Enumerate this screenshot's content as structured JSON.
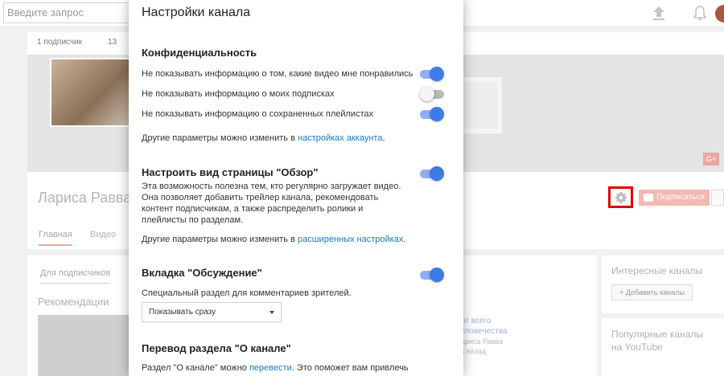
{
  "topbar": {
    "search_placeholder": "Введите запрос"
  },
  "channel": {
    "subscribers_text": "1 подписчик",
    "views_text": "13",
    "name": "Лариса Равва",
    "tabs": [
      "Главная",
      "Видео"
    ],
    "subscribe_label": "Подписаться",
    "gplus_label": "G+"
  },
  "content": {
    "for_subscribers_tab": "Для подписчиков",
    "recommendations_title": "Рекомендации",
    "video_title_line1": "- от всего",
    "video_title_line2": "человечества",
    "video_author": "Лариса Равва",
    "video_age": "да назад"
  },
  "sidebar": {
    "interesting_title": "Интересные каналы",
    "add_channels_label": "+ Добавить каналы",
    "popular_title": "Популярные каналы на YouTube"
  },
  "dialog": {
    "title": "Настройки канала",
    "privacy": {
      "heading": "Конфиденциальность",
      "items": [
        {
          "label": "Не показывать информацию о том, какие видео мне понравились",
          "on": true
        },
        {
          "label": "Не показывать информацию о моих подписках",
          "on": false
        },
        {
          "label": "Не показывать информацию о сохраненных плейлистах",
          "on": true
        }
      ],
      "note_prefix": "Другие параметры можно изменить в ",
      "note_link": "настройках аккаунта",
      "note_suffix": "."
    },
    "overview": {
      "heading": "Настроить вид страницы \"Обзор\"",
      "on": true,
      "desc_lines": [
        "Эта возможность полезна тем, кто регулярно загружает видео.",
        "Она позволяет добавить трейлер канала, рекомендовать",
        "контент подписчикам, а также распределить ролики и",
        "плейлисты по разделам."
      ],
      "note_prefix": "Другие параметры можно изменить в ",
      "note_link": "расширенных настройках",
      "note_suffix": "."
    },
    "discussion": {
      "heading": "Вкладка \"Обсуждение\"",
      "on": true,
      "desc": "Специальный раздел для комментариев зрителей.",
      "select_value": "Показывать сразу"
    },
    "about": {
      "heading": "Перевод раздела \"О канале\"",
      "desc_prefix": "Раздел \"О канале\" можно ",
      "desc_link": "перевести",
      "desc_suffix": ". Это поможет вам привлечь"
    }
  },
  "colors": {
    "toggle_on_knob": "#3f7be4",
    "toggle_on_track": "#90aef2",
    "link": "#167ac6",
    "highlight_box": "#e00000"
  }
}
